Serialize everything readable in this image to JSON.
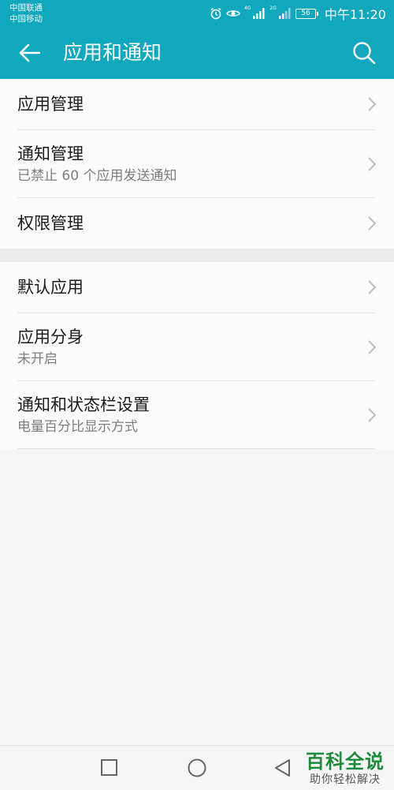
{
  "status_bar": {
    "carrier_1": "中国联通",
    "carrier_2": "中国移动",
    "net_1": "4G",
    "net_2": "2G",
    "battery": "56",
    "time": "中午11:20"
  },
  "app_bar": {
    "title": "应用和通知",
    "back_icon": "arrow-left-icon",
    "search_icon": "search-icon"
  },
  "groups": [
    {
      "items": [
        {
          "title": "应用管理"
        },
        {
          "title": "通知管理",
          "subtitle": "已禁止 60 个应用发送通知"
        },
        {
          "title": "权限管理"
        }
      ]
    },
    {
      "items": [
        {
          "title": "默认应用"
        },
        {
          "title": "应用分身",
          "subtitle": "未开启"
        },
        {
          "title": "通知和状态栏设置",
          "subtitle": "电量百分比显示方式"
        }
      ]
    }
  ],
  "nav_bar": {
    "recents_icon": "square-icon",
    "home_icon": "circle-icon",
    "back_icon": "triangle-back-icon"
  },
  "watermark": {
    "title": "百科全说",
    "subtitle": "助你轻松解决"
  },
  "colors": {
    "accent": "#11a8be",
    "background": "#f6f6f6"
  }
}
